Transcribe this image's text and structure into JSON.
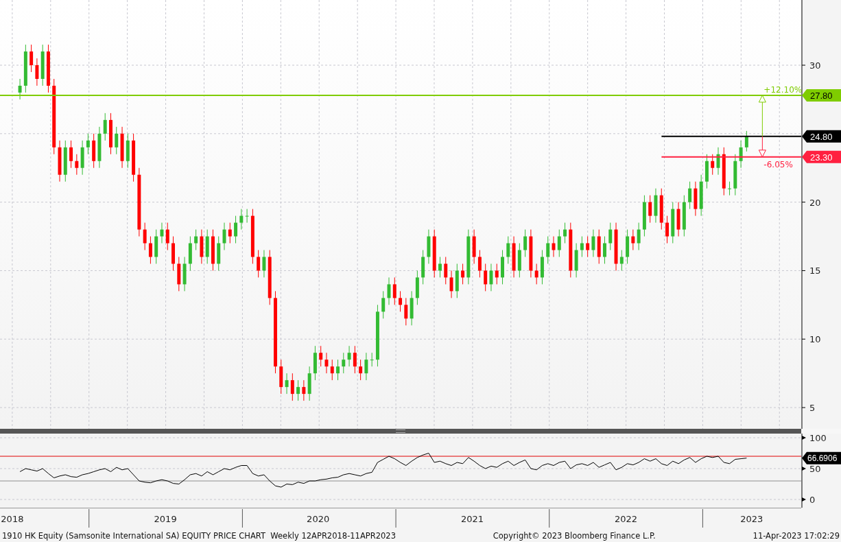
{
  "price_chart": {
    "chart_data": {
      "type": "candlestick",
      "grid": true,
      "xlim": [
        2018.42,
        2023.642
      ],
      "ylim": [
        3.45,
        34.76
      ],
      "yticks": [
        {
          "value": 5,
          "label": "5"
        },
        {
          "value": 10,
          "label": "10"
        },
        {
          "value": 15,
          "label": "15"
        },
        {
          "value": 20,
          "label": "20"
        },
        {
          "value": 30,
          "label": "30"
        }
      ],
      "xticks": [
        {
          "value": 2018.5,
          "label": "2018"
        },
        {
          "value": 2019.498,
          "label": "2019"
        },
        {
          "value": 2020.493,
          "label": "2020"
        },
        {
          "value": 2021.498,
          "label": "2021"
        },
        {
          "value": 2022.5,
          "label": "2022"
        },
        {
          "value": 2023.319,
          "label": "2023"
        }
      ],
      "x": [
        2018.55,
        2018.587,
        2018.624,
        2018.661,
        2018.698,
        2018.735,
        2018.772,
        2018.809,
        2018.846,
        2018.883,
        2018.92,
        2018.957,
        2018.994,
        2019.031,
        2019.068,
        2019.105,
        2019.142,
        2019.179,
        2019.216,
        2019.253,
        2019.29,
        2019.327,
        2019.364,
        2019.401,
        2019.438,
        2019.475,
        2019.512,
        2019.549,
        2019.586,
        2019.623,
        2019.66,
        2019.697,
        2019.734,
        2019.771,
        2019.808,
        2019.845,
        2019.882,
        2019.919,
        2019.956,
        2019.993,
        2020.03,
        2020.067,
        2020.104,
        2020.141,
        2020.178,
        2020.215,
        2020.252,
        2020.289,
        2020.326,
        2020.363,
        2020.4,
        2020.437,
        2020.474,
        2020.511,
        2020.548,
        2020.585,
        2020.622,
        2020.659,
        2020.696,
        2020.733,
        2020.77,
        2020.807,
        2020.844,
        2020.881,
        2020.918,
        2020.955,
        2020.992,
        2021.029,
        2021.066,
        2021.103,
        2021.14,
        2021.177,
        2021.214,
        2021.251,
        2021.288,
        2021.325,
        2021.362,
        2021.399,
        2021.436,
        2021.473,
        2021.51,
        2021.547,
        2021.584,
        2021.621,
        2021.658,
        2021.695,
        2021.732,
        2021.769,
        2021.806,
        2021.843,
        2021.88,
        2021.917,
        2021.954,
        2021.991,
        2022.028,
        2022.065,
        2022.102,
        2022.139,
        2022.176,
        2022.213,
        2022.25,
        2022.287,
        2022.324,
        2022.361,
        2022.398,
        2022.435,
        2022.472,
        2022.509,
        2022.546,
        2022.583,
        2022.62,
        2022.657,
        2022.694,
        2022.731,
        2022.768,
        2022.805,
        2022.842,
        2022.879,
        2022.916,
        2022.953,
        2022.99,
        2023.027,
        2023.064,
        2023.101,
        2023.138,
        2023.175,
        2023.212,
        2023.249,
        2023.286
      ],
      "ohlc": [
        [
          28,
          29,
          27.5,
          28.5
        ],
        [
          28.5,
          31.5,
          28,
          31
        ],
        [
          31,
          31.5,
          29.5,
          30
        ],
        [
          30,
          30.5,
          28.5,
          29
        ],
        [
          29,
          31.5,
          28.5,
          31
        ],
        [
          31,
          31.5,
          28,
          28.5
        ],
        [
          28.5,
          29,
          23.5,
          24
        ],
        [
          24,
          24.5,
          21.5,
          22
        ],
        [
          22,
          24.5,
          21.5,
          24
        ],
        [
          24,
          24.5,
          22.5,
          23
        ],
        [
          23,
          23.5,
          22,
          22.5
        ],
        [
          22.5,
          24.5,
          22,
          24
        ],
        [
          24,
          25,
          23.5,
          24.5
        ],
        [
          24.5,
          25,
          22.5,
          23
        ],
        [
          23,
          25.5,
          22.5,
          25
        ],
        [
          25,
          26.5,
          24.5,
          26
        ],
        [
          26,
          26.5,
          23.5,
          24
        ],
        [
          24,
          25.5,
          23.5,
          25
        ],
        [
          25,
          25.5,
          22.5,
          23
        ],
        [
          23,
          25,
          22.5,
          24.5
        ],
        [
          24.5,
          25,
          21.5,
          22
        ],
        [
          22,
          22.5,
          17.5,
          18
        ],
        [
          18,
          18.5,
          16.5,
          17
        ],
        [
          17,
          17.5,
          15.5,
          16
        ],
        [
          16,
          18,
          15.5,
          17.5
        ],
        [
          17.5,
          18.5,
          17,
          18
        ],
        [
          18,
          18.5,
          16.5,
          17
        ],
        [
          17,
          17.5,
          15,
          15.5
        ],
        [
          15.5,
          16,
          13.5,
          14
        ],
        [
          14,
          16,
          13.5,
          15.5
        ],
        [
          15.5,
          17.5,
          15,
          17
        ],
        [
          17,
          18,
          16.5,
          17.5
        ],
        [
          17.5,
          18,
          15.5,
          16
        ],
        [
          16,
          18,
          15.5,
          17.5
        ],
        [
          17.5,
          18,
          15,
          15.5
        ],
        [
          15.5,
          17.5,
          15,
          17
        ],
        [
          17,
          18.5,
          16.5,
          18
        ],
        [
          18,
          18.5,
          17,
          17.5
        ],
        [
          17.5,
          19,
          17,
          18.5
        ],
        [
          18.5,
          19.5,
          18,
          19
        ],
        [
          19,
          19.5,
          18.5,
          19
        ],
        [
          19,
          19.5,
          15.5,
          16
        ],
        [
          16,
          16.5,
          14.5,
          15
        ],
        [
          15,
          16.5,
          14.5,
          16
        ],
        [
          16,
          16.5,
          12.5,
          13
        ],
        [
          13,
          13.5,
          7.5,
          8
        ],
        [
          8,
          8.5,
          6,
          6.5
        ],
        [
          6.5,
          7.5,
          6,
          7
        ],
        [
          7,
          7.5,
          5.5,
          6
        ],
        [
          6,
          7,
          5.5,
          6.5
        ],
        [
          6.5,
          7,
          5.5,
          6
        ],
        [
          6,
          8,
          5.5,
          7.5
        ],
        [
          7.5,
          9.5,
          7,
          9
        ],
        [
          9,
          9.5,
          8,
          8.5
        ],
        [
          8.5,
          9,
          7.5,
          8
        ],
        [
          8,
          8.5,
          7,
          7.5
        ],
        [
          7.5,
          8.5,
          7,
          8
        ],
        [
          8,
          9,
          7.5,
          8.5
        ],
        [
          8.5,
          9.5,
          8,
          9
        ],
        [
          9,
          9.5,
          7.5,
          8
        ],
        [
          8,
          8.5,
          7,
          7.5
        ],
        [
          7.5,
          9,
          7,
          8.5
        ],
        [
          8.5,
          9,
          8,
          8.5
        ],
        [
          8.5,
          12.5,
          8,
          12
        ],
        [
          12,
          13.5,
          11.5,
          13
        ],
        [
          13,
          14.5,
          12.5,
          14
        ],
        [
          14,
          14.5,
          12.5,
          13
        ],
        [
          13,
          13.5,
          12,
          12.5
        ],
        [
          12.5,
          13,
          11,
          11.5
        ],
        [
          11.5,
          13.5,
          11,
          13
        ],
        [
          13,
          15,
          12.5,
          14.5
        ],
        [
          14.5,
          16.5,
          14,
          16
        ],
        [
          16,
          18,
          15.5,
          17.5
        ],
        [
          17.5,
          18,
          14.5,
          15
        ],
        [
          15,
          16,
          14.5,
          15.5
        ],
        [
          15.5,
          16,
          14,
          14.5
        ],
        [
          14.5,
          15,
          13,
          13.5
        ],
        [
          13.5,
          15.5,
          13,
          15
        ],
        [
          15,
          15.5,
          14,
          14.5
        ],
        [
          14.5,
          18,
          14,
          17.5
        ],
        [
          17.5,
          18,
          15.5,
          16
        ],
        [
          16,
          16.5,
          14.5,
          15
        ],
        [
          15,
          15.5,
          13.5,
          14
        ],
        [
          14,
          15.5,
          13.5,
          15
        ],
        [
          15,
          15.5,
          14,
          14.5
        ],
        [
          14.5,
          16.5,
          14,
          16
        ],
        [
          16,
          17.5,
          15.5,
          17
        ],
        [
          17,
          17.5,
          14.5,
          15
        ],
        [
          15,
          17,
          14.5,
          16.5
        ],
        [
          16.5,
          18,
          16,
          17.5
        ],
        [
          17.5,
          18,
          14.5,
          15
        ],
        [
          15,
          15.5,
          14,
          14.5
        ],
        [
          14.5,
          16.5,
          14,
          16
        ],
        [
          16,
          17.5,
          15.5,
          17
        ],
        [
          17,
          17.5,
          16,
          16.5
        ],
        [
          16.5,
          18,
          16,
          17.5
        ],
        [
          17.5,
          18.5,
          17,
          18
        ],
        [
          18,
          18.5,
          14.5,
          15
        ],
        [
          15,
          17,
          14.5,
          16.5
        ],
        [
          16.5,
          17.5,
          16,
          17
        ],
        [
          17,
          17.5,
          16,
          16.5
        ],
        [
          16.5,
          18,
          16,
          17.5
        ],
        [
          17.5,
          18,
          15.5,
          16
        ],
        [
          16,
          17.5,
          15.5,
          17
        ],
        [
          17,
          18.5,
          16.5,
          18
        ],
        [
          18,
          18.5,
          15,
          15.5
        ],
        [
          15.5,
          16.5,
          15,
          16
        ],
        [
          16,
          18,
          15.5,
          17.5
        ],
        [
          17.5,
          18,
          16.5,
          17
        ],
        [
          17,
          18.5,
          16.5,
          18
        ],
        [
          18,
          20.5,
          17.5,
          20
        ],
        [
          20,
          20.5,
          18.5,
          19
        ],
        [
          19,
          21,
          18.5,
          20.5
        ],
        [
          20.5,
          21,
          18,
          18.5
        ],
        [
          18.5,
          19,
          17,
          17.5
        ],
        [
          17.5,
          20,
          17,
          19.5
        ],
        [
          19.5,
          20,
          17.5,
          18
        ],
        [
          18,
          20.5,
          17.5,
          20
        ],
        [
          20,
          21.5,
          19.5,
          21
        ],
        [
          21,
          21.5,
          19,
          19.5
        ],
        [
          19.5,
          22,
          19,
          21.5
        ],
        [
          21.5,
          23.5,
          21,
          23
        ],
        [
          23,
          23.5,
          22,
          22.5
        ],
        [
          22.5,
          24,
          22,
          23.5
        ],
        [
          23.5,
          24,
          20.5,
          21
        ],
        [
          21,
          21.5,
          20.5,
          21
        ],
        [
          21,
          23.5,
          20.5,
          23
        ],
        [
          23,
          24.5,
          22.5,
          24
        ],
        [
          24,
          25.2,
          23.7,
          24.8
        ]
      ],
      "ref_lines": [
        {
          "axis": "y",
          "value": 27.8,
          "label": "27.80",
          "color": "#7fcc00"
        },
        {
          "axis": "y",
          "value": 24.8,
          "label": "24.80",
          "color": "#000000"
        },
        {
          "axis": "y",
          "value": 23.3,
          "label": "23.30",
          "color": "#ff2040"
        }
      ],
      "annotations": [
        "+12.10%",
        "-6.05%"
      ]
    }
  },
  "rsi_chart": {
    "chart_data": {
      "type": "line",
      "grid": true,
      "xlim": [
        2018.42,
        2023.642
      ],
      "ylim": [
        -13.3,
        106.7
      ],
      "yticks": [
        0,
        50,
        100
      ],
      "x": [
        2018.55,
        2018.587,
        2018.624,
        2018.661,
        2018.698,
        2018.735,
        2018.772,
        2018.809,
        2018.846,
        2018.883,
        2018.92,
        2018.957,
        2018.994,
        2019.031,
        2019.068,
        2019.105,
        2019.142,
        2019.179,
        2019.216,
        2019.253,
        2019.29,
        2019.327,
        2019.364,
        2019.401,
        2019.438,
        2019.475,
        2019.512,
        2019.549,
        2019.586,
        2019.623,
        2019.66,
        2019.697,
        2019.734,
        2019.771,
        2019.808,
        2019.845,
        2019.882,
        2019.919,
        2019.956,
        2019.993,
        2020.03,
        2020.067,
        2020.104,
        2020.141,
        2020.178,
        2020.215,
        2020.252,
        2020.289,
        2020.326,
        2020.363,
        2020.4,
        2020.437,
        2020.474,
        2020.511,
        2020.548,
        2020.585,
        2020.622,
        2020.659,
        2020.696,
        2020.733,
        2020.77,
        2020.807,
        2020.844,
        2020.881,
        2020.918,
        2020.955,
        2020.992,
        2021.029,
        2021.066,
        2021.103,
        2021.14,
        2021.177,
        2021.214,
        2021.251,
        2021.288,
        2021.325,
        2021.362,
        2021.399,
        2021.436,
        2021.473,
        2021.51,
        2021.547,
        2021.584,
        2021.621,
        2021.658,
        2021.695,
        2021.732,
        2021.769,
        2021.806,
        2021.843,
        2021.88,
        2021.917,
        2021.954,
        2021.991,
        2022.028,
        2022.065,
        2022.102,
        2022.139,
        2022.176,
        2022.213,
        2022.25,
        2022.287,
        2022.324,
        2022.361,
        2022.398,
        2022.435,
        2022.472,
        2022.509,
        2022.546,
        2022.583,
        2022.62,
        2022.657,
        2022.694,
        2022.731,
        2022.768,
        2022.805,
        2022.842,
        2022.879,
        2022.916,
        2022.953,
        2022.99,
        2023.027,
        2023.064,
        2023.101,
        2023.138,
        2023.175,
        2023.212,
        2023.249,
        2023.286
      ],
      "series": [
        {
          "color": "#000000",
          "values": [
            45,
            50,
            48,
            46,
            50,
            42,
            35,
            38,
            40,
            37,
            36,
            40,
            42,
            45,
            48,
            50,
            45,
            52,
            48,
            50,
            40,
            30,
            28,
            27,
            30,
            32,
            30,
            26,
            25,
            32,
            40,
            42,
            38,
            45,
            40,
            45,
            50,
            48,
            52,
            55,
            55,
            42,
            38,
            40,
            30,
            22,
            20,
            25,
            24,
            28,
            26,
            30,
            30,
            32,
            33,
            35,
            36,
            40,
            42,
            40,
            38,
            42,
            44,
            60,
            65,
            70,
            66,
            60,
            55,
            62,
            68,
            72,
            75,
            60,
            62,
            58,
            55,
            60,
            58,
            68,
            62,
            55,
            50,
            54,
            52,
            58,
            62,
            55,
            60,
            64,
            50,
            48,
            55,
            58,
            55,
            60,
            62,
            50,
            56,
            58,
            55,
            60,
            52,
            56,
            60,
            48,
            52,
            58,
            56,
            60,
            66,
            62,
            66,
            58,
            55,
            62,
            58,
            64,
            68,
            60,
            66,
            70,
            68,
            70,
            60,
            58,
            65,
            66,
            67
          ]
        }
      ],
      "ref_lines": [
        {
          "axis": "y",
          "value": 70,
          "color": "#e00000"
        },
        {
          "axis": "y",
          "value": 30,
          "color": "#909090"
        }
      ],
      "annotations": [
        "66.6906"
      ]
    }
  },
  "footer": {
    "description": "1910 HK Equity (Samsonite International SA) EQUITY PRICE CHART  Weekly 12APR2018-11APR2023",
    "copyright": "Copyright© 2023 Bloomberg Finance L.P.",
    "timestamp": "11-Apr-2023 17:02:29"
  }
}
